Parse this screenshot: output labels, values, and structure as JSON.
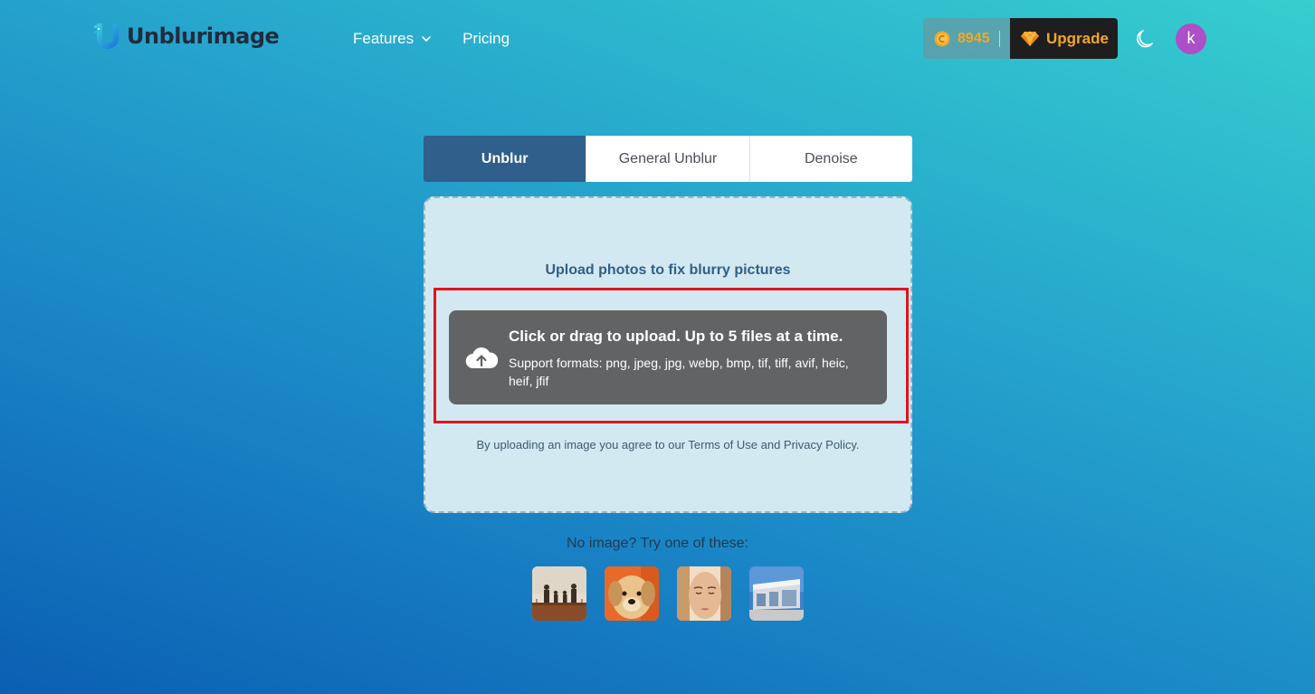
{
  "brand": {
    "logo_text": "Unblurimage"
  },
  "nav": {
    "items": [
      {
        "label": "Features",
        "has_dropdown": true
      },
      {
        "label": "Pricing",
        "has_dropdown": false
      }
    ]
  },
  "account": {
    "coins": "8945",
    "upgrade_label": "Upgrade",
    "avatar_initial": "k",
    "avatar_color": "#ad4fc6",
    "theme_toggle_icon": "moon-icon"
  },
  "tabs": [
    {
      "label": "Unblur",
      "active": true
    },
    {
      "label": "General Unblur",
      "active": false
    },
    {
      "label": "Denoise",
      "active": false
    }
  ],
  "upload": {
    "title": "Upload photos to fix blurry pictures",
    "dropzone_title": "Click or drag to upload. Up to 5 files at a time.",
    "formats": "Support formats: png, jpeg, jpg, webp, bmp, tif, tiff, avif, heic, heif, jfif",
    "terms_prefix": "By uploading an image you agree to our ",
    "terms_link": "Terms of Use",
    "terms_and": " and ",
    "privacy_link": "Privacy Policy",
    "terms_suffix": "."
  },
  "samples": {
    "title": "No image? Try one of these:",
    "items": [
      {
        "name": "family-silhouette"
      },
      {
        "name": "puppy"
      },
      {
        "name": "woman-face"
      },
      {
        "name": "building"
      }
    ]
  },
  "colors": {
    "accent": "#2f5f8a",
    "coin": "#f5a623",
    "highlight": "#e0141e"
  }
}
